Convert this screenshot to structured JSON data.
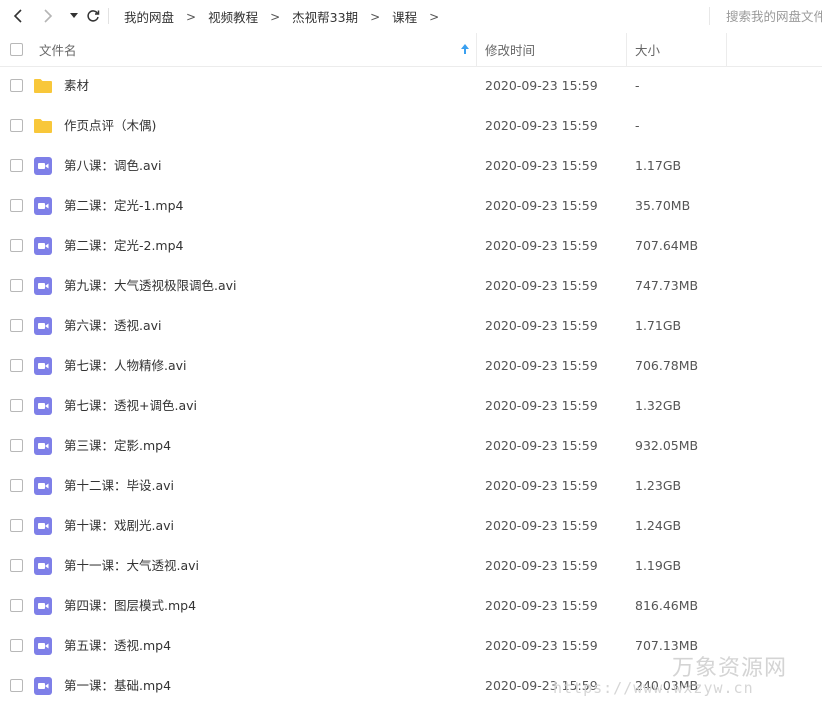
{
  "breadcrumb": [
    "我的网盘",
    "视频教程",
    "杰视帮33期",
    "课程"
  ],
  "search": {
    "placeholder": "搜索我的网盘文件"
  },
  "columns": {
    "name": "文件名",
    "modified": "修改时间",
    "size": "大小"
  },
  "colors": {
    "folder": "#f8c73a",
    "video": "#7e7fe8",
    "sort_arrow": "#3aa0f0"
  },
  "files": [
    {
      "name": "素材",
      "type": "folder",
      "modified": "2020-09-23 15:59",
      "size": "-"
    },
    {
      "name": "作页点评（木偶)",
      "type": "folder",
      "modified": "2020-09-23 15:59",
      "size": "-"
    },
    {
      "name": "第八课：调色.avi",
      "type": "video",
      "modified": "2020-09-23 15:59",
      "size": "1.17GB"
    },
    {
      "name": "第二课：定光-1.mp4",
      "type": "video",
      "modified": "2020-09-23 15:59",
      "size": "35.70MB"
    },
    {
      "name": "第二课：定光-2.mp4",
      "type": "video",
      "modified": "2020-09-23 15:59",
      "size": "707.64MB"
    },
    {
      "name": "第九课：大气透视极限调色.avi",
      "type": "video",
      "modified": "2020-09-23 15:59",
      "size": "747.73MB"
    },
    {
      "name": "第六课：透视.avi",
      "type": "video",
      "modified": "2020-09-23 15:59",
      "size": "1.71GB"
    },
    {
      "name": "第七课：人物精修.avi",
      "type": "video",
      "modified": "2020-09-23 15:59",
      "size": "706.78MB"
    },
    {
      "name": "第七课：透视+调色.avi",
      "type": "video",
      "modified": "2020-09-23 15:59",
      "size": "1.32GB"
    },
    {
      "name": "第三课：定影.mp4",
      "type": "video",
      "modified": "2020-09-23 15:59",
      "size": "932.05MB"
    },
    {
      "name": "第十二课：毕设.avi",
      "type": "video",
      "modified": "2020-09-23 15:59",
      "size": "1.23GB"
    },
    {
      "name": "第十课：戏剧光.avi",
      "type": "video",
      "modified": "2020-09-23 15:59",
      "size": "1.24GB"
    },
    {
      "name": "第十一课：大气透视.avi",
      "type": "video",
      "modified": "2020-09-23 15:59",
      "size": "1.19GB"
    },
    {
      "name": "第四课：图层模式.mp4",
      "type": "video",
      "modified": "2020-09-23 15:59",
      "size": "816.46MB"
    },
    {
      "name": "第五课：透视.mp4",
      "type": "video",
      "modified": "2020-09-23 15:59",
      "size": "707.13MB"
    },
    {
      "name": "第一课：基础.mp4",
      "type": "video",
      "modified": "2020-09-23 15:59",
      "size": "240.03MB"
    }
  ],
  "watermark": {
    "title": "万象资源网",
    "url": "https://www.wxzyw.cn"
  }
}
